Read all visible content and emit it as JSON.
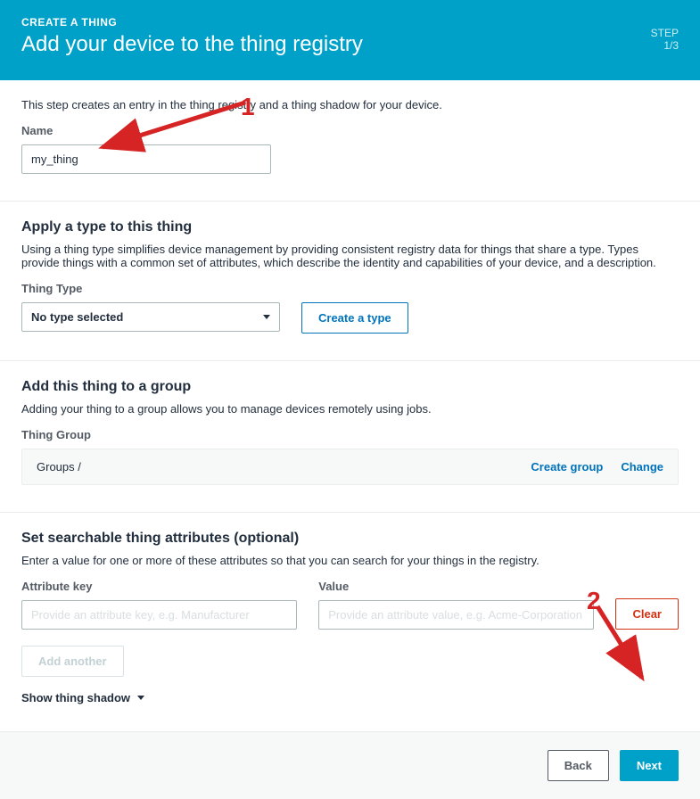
{
  "header": {
    "breadcrumb": "Create a Thing",
    "title": "Add your device to the thing registry",
    "step_label": "STEP",
    "step_value": "1/3"
  },
  "section1": {
    "helptext": "This step creates an entry in the thing registry and a thing shadow for your device.",
    "name_label": "Name",
    "name_value": "my_thing"
  },
  "section2": {
    "title": "Apply a type to this thing",
    "helptext": "Using a thing type simplifies device management by providing consistent registry data for things that share a type. Types provide things with a common set of attributes, which describe the identity and capabilities of your device, and a description.",
    "type_label": "Thing Type",
    "type_selected": "No type selected",
    "create_type_btn": "Create a type"
  },
  "section3": {
    "title": "Add this thing to a group",
    "helptext": "Adding your thing to a group allows you to manage devices remotely using jobs.",
    "group_label": "Thing Group",
    "group_path": "Groups /",
    "create_group": "Create group",
    "change": "Change"
  },
  "section4": {
    "title": "Set searchable thing attributes (optional)",
    "helptext": "Enter a value for one or more of these attributes so that you can search for your things in the registry.",
    "attr_key_label": "Attribute key",
    "attr_key_placeholder": "Provide an attribute key, e.g. Manufacturer",
    "value_label": "Value",
    "value_placeholder": "Provide an attribute value, e.g. Acme-Corporation",
    "clear_btn": "Clear",
    "add_another_btn": "Add another",
    "show_shadow": "Show thing shadow"
  },
  "footer": {
    "back": "Back",
    "next": "Next"
  },
  "annotations": {
    "one": "1",
    "two": "2"
  }
}
